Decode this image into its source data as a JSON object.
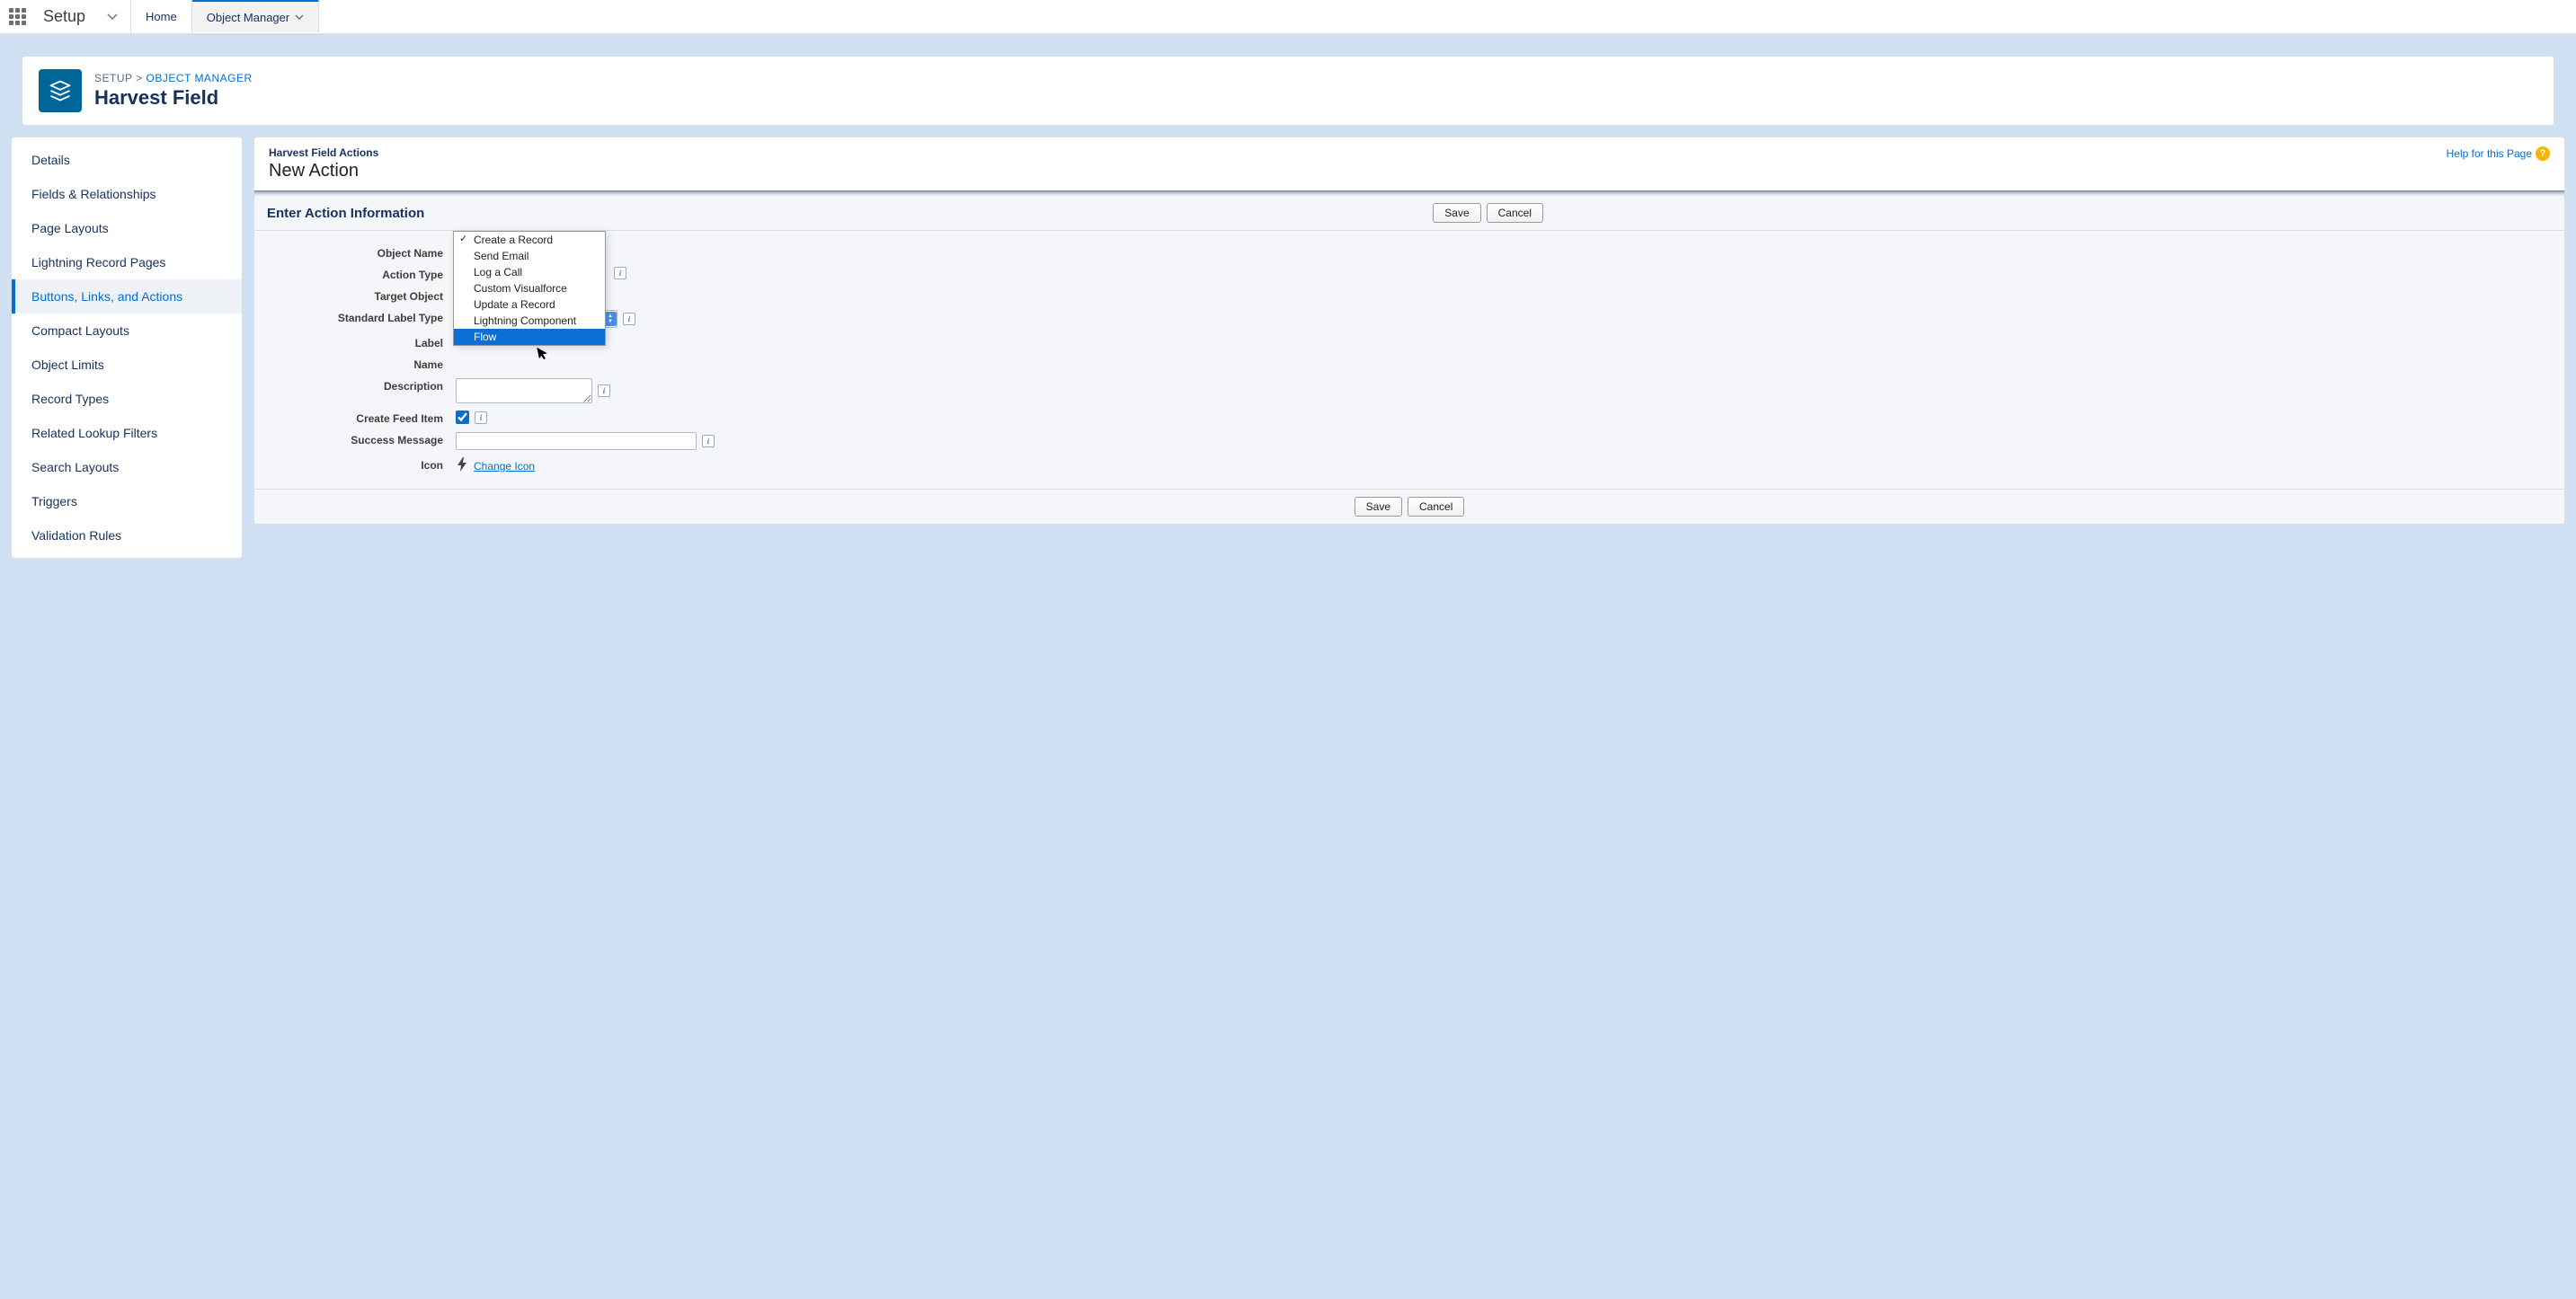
{
  "topnav": {
    "app_name": "Setup",
    "tabs": [
      {
        "label": "Home",
        "active": false
      },
      {
        "label": "Object Manager",
        "active": true
      }
    ]
  },
  "header": {
    "breadcrumb_setup": "SETUP",
    "breadcrumb_separator": " > ",
    "breadcrumb_link": "OBJECT MANAGER",
    "title": "Harvest Field"
  },
  "sidebar": {
    "items": [
      "Details",
      "Fields & Relationships",
      "Page Layouts",
      "Lightning Record Pages",
      "Buttons, Links, and Actions",
      "Compact Layouts",
      "Object Limits",
      "Record Types",
      "Related Lookup Filters",
      "Search Layouts",
      "Triggers",
      "Validation Rules"
    ],
    "selected_index": 4
  },
  "main": {
    "subhead": "Harvest Field Actions",
    "title": "New Action",
    "help_label": "Help for this Page",
    "section_title": "Enter Action Information",
    "save_label": "Save",
    "cancel_label": "Cancel",
    "form": {
      "object_name_label": "Object Name",
      "object_name_value": "Harvest Field",
      "action_type_label": "Action Type",
      "target_object_label": "Target Object",
      "std_label_type_label": "Standard Label Type",
      "label_label": "Label",
      "name_label": "Name",
      "description_label": "Description",
      "create_feed_label": "Create Feed Item",
      "success_msg_label": "Success Message",
      "icon_label": "Icon",
      "change_icon": "Change Icon"
    },
    "dropdown": {
      "options": [
        "Create a Record",
        "Send Email",
        "Log a Call",
        "Custom Visualforce",
        "Update a Record",
        "Lightning Component",
        "Flow"
      ],
      "checked_index": 0,
      "highlighted_index": 6
    }
  }
}
